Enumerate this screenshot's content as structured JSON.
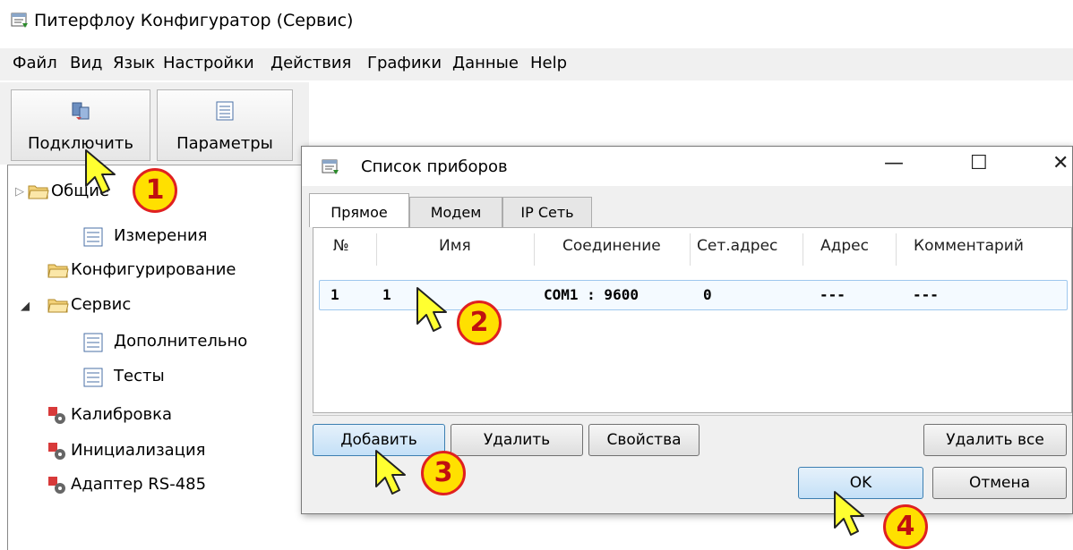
{
  "app": {
    "title": "Питерфлоу Конфигуратор (Сервис)"
  },
  "menu": [
    "Файл",
    "Вид",
    "Язык",
    "Настройки",
    "Действия",
    "Графики",
    "Данные",
    "Help"
  ],
  "toolbar": {
    "connect_label": "Подключить",
    "params_label": "Параметры"
  },
  "tree": {
    "general_label": "Общие",
    "measurements_label": "Измерения",
    "config_label": "Конфигурирование",
    "service_label": "Сервис",
    "extra_label": "Дополнительно",
    "tests_label": "Тесты",
    "calibration_label": "Калибровка",
    "init_label": "Инициализация",
    "adapter_label": "Адаптер RS-485"
  },
  "dialog": {
    "title": "Список приборов",
    "minimize": "—",
    "maximize": "☐",
    "close": "✕",
    "tabs": [
      "Прямое",
      "Модем",
      "IP Сеть"
    ],
    "columns": [
      "№",
      "Имя",
      "Соединение",
      "Сет.адрес",
      "Адрес",
      "Комментарий"
    ],
    "rows": [
      {
        "num": "1",
        "name": "1",
        "conn": "COM1 : 9600",
        "net": "0",
        "addr": "---",
        "comment": "---"
      }
    ],
    "add_label": "Добавить",
    "delete_label": "Удалить",
    "props_label": "Свойства",
    "delete_all_label": "Удалить все",
    "ok_label": "OK",
    "cancel_label": "Отмена"
  },
  "badges": [
    "1",
    "2",
    "3",
    "4"
  ],
  "colors": {
    "badge_fill": "#ffe000",
    "badge_border": "#e02020",
    "cursor_fill": "#ffff30"
  }
}
